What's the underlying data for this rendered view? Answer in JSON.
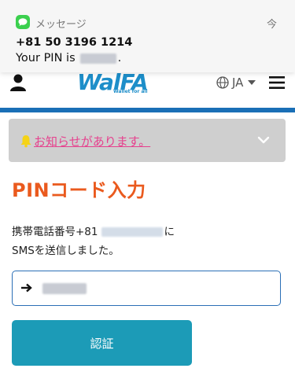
{
  "notification": {
    "app_name": "メッセージ",
    "time": "今",
    "sender": "+81 50 3196 1214",
    "body_prefix": "Your PIN is",
    "body_suffix": "."
  },
  "header": {
    "logo_text": "WalFA",
    "logo_sub": "Wallet for all",
    "language": "JA",
    "icons": [
      "user-icon",
      "globe-icon",
      "menu-icon"
    ]
  },
  "announcement": {
    "text": "お知らせがあります。"
  },
  "main": {
    "title": "PINコード入力",
    "desc_prefix": "携帯電話番号+81",
    "desc_suffix": "に",
    "desc_line2": "SMSを送信しました。",
    "submit_label": "認証"
  },
  "colors": {
    "title": "#ea5a1e",
    "announcement_text": "#e6418e",
    "submit_bg": "#1c9bb7",
    "header_rule": "#1a6fb6",
    "input_border": "#2b6fb6"
  }
}
